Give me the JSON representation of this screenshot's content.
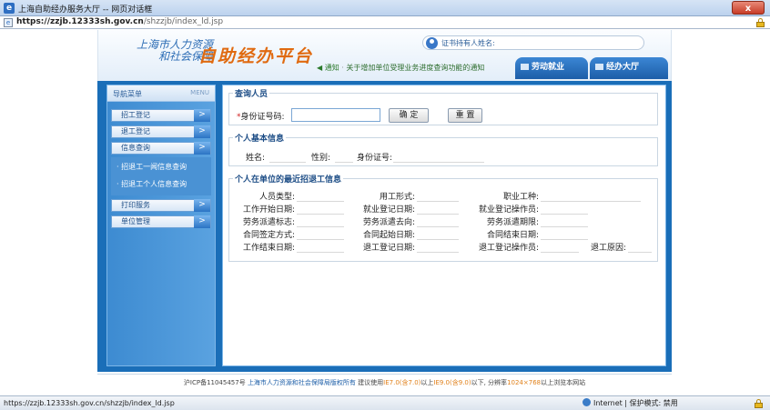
{
  "window": {
    "title": "上海自助经办服务大厅 -- 网页对话框",
    "close_label": "x"
  },
  "address": {
    "host": "https://zzjb.12333sh.gov.cn",
    "path": "/shzzjb/index_ld.jsp"
  },
  "header": {
    "org_line1": "上海市人力资源",
    "org_line2": "和社会保障",
    "platform": "自助经办平台",
    "holder_label": "证书持有人姓名:",
    "notice_prefix": "◀ 通知",
    "notice_sep": "·",
    "notice_text": "关于增加单位受理业务进度查询功能的通知",
    "tabs": [
      {
        "label": "劳动就业"
      },
      {
        "label": "经办大厅"
      }
    ]
  },
  "sidebar": {
    "head_title": "导航菜单",
    "head_menu": "MENU",
    "items": [
      {
        "label": "招工登记"
      },
      {
        "label": "退工登记"
      },
      {
        "label": "信息查询"
      }
    ],
    "sub_items": [
      {
        "label": "· 招退工一闻信息查询"
      },
      {
        "label": "· 招退工个人信息查询"
      }
    ],
    "items2": [
      {
        "label": "打印服务"
      },
      {
        "label": "单位管理"
      }
    ],
    "arrow": ">"
  },
  "query": {
    "legend": "查询人员",
    "required_mark": "*",
    "id_label": "身份证号码:",
    "id_value": "",
    "confirm_label": "确 定",
    "reset_label": "重 置"
  },
  "basic": {
    "legend": "个人基本信息",
    "name_label": "姓名:",
    "gender_label": "性别:",
    "id_label": "身份证号:"
  },
  "recent": {
    "legend": "个人在单位的最近招退工信息",
    "rows": [
      [
        "人员类型:",
        "用工形式:",
        "职业工种:",
        ""
      ],
      [
        "工作开始日期:",
        "就业登记日期:",
        "就业登记操作员:",
        ""
      ],
      [
        "劳务派遣标志:",
        "劳务派遣去向:",
        "劳务派遣期限:",
        ""
      ],
      [
        "合同签定方式:",
        "合同起始日期:",
        "合同结束日期:",
        ""
      ],
      [
        "工作结束日期:",
        "退工登记日期:",
        "退工登记操作员:",
        "退工原因:"
      ]
    ]
  },
  "footer": {
    "icp": "沪ICP备11045457号",
    "org": "上海市人力资源和社会保障局版权所有",
    "hint_a": "建议使用",
    "ie7": "IE7.0(含7.0)",
    "hint_b": "以上",
    "ie9": "IE9.0(含9.0)",
    "hint_c": "以下, 分辨率",
    "res": "1024×768",
    "hint_d": "以上浏览本网站"
  },
  "status": {
    "url": "https://zzjb.12333sh.gov.cn/shzzjb/index_ld.jsp",
    "zone": "Internet | 保护模式: 禁用"
  }
}
